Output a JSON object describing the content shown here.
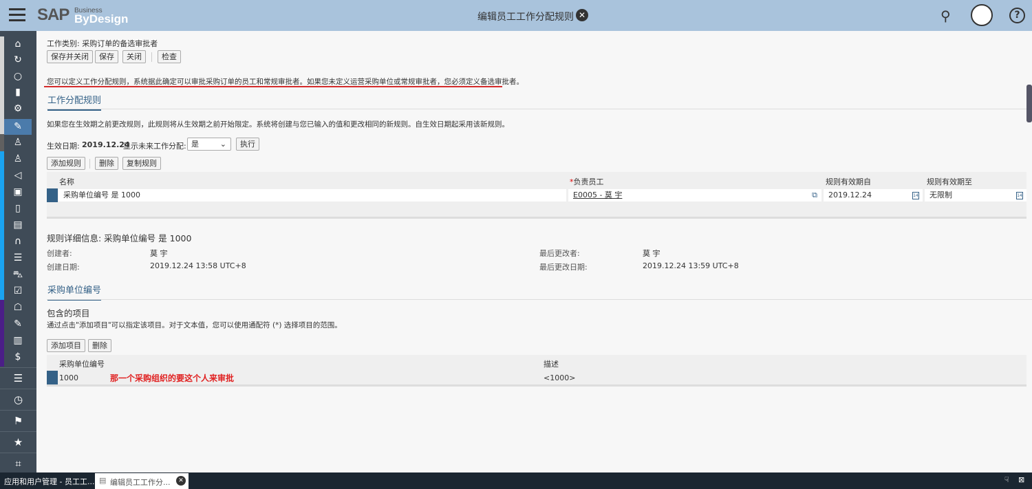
{
  "header": {
    "logo": "SAP",
    "logo_sub1": "Business",
    "logo_sub2": "ByDesign",
    "title": "编辑员工工作分配规则"
  },
  "sidebar": {
    "icons": [
      "home-icon",
      "refresh-icon",
      "circle-icon",
      "chart-icon",
      "gears-icon",
      "user-edit-icon",
      "org-icon",
      "user-list-icon",
      "megaphone-icon",
      "contact-card-icon",
      "invoice-icon",
      "employee-cost-icon",
      "headset-icon",
      "checklist-icon",
      "car-icon",
      "clipboard-check-icon",
      "handshake-icon",
      "edit-doc-icon",
      "receipt-icon",
      "expense-icon"
    ],
    "strip_colors": [
      "#d5d5d5",
      "#606060",
      "#1aa3f0",
      "#4b1e87"
    ]
  },
  "toolbar": {
    "work_category_label": "工作类别:",
    "work_category": "采购订单的备选审批者",
    "save_close": "保存并关闭",
    "save": "保存",
    "close": "关闭",
    "check": "检查"
  },
  "info": "您可以定义工作分配规则，系统据此确定可以审批采购订单的员工和常规审批者。如果您未定义运营采购单位或常规审批者，您必须定义备选审批者。",
  "rules": {
    "tab": "工作分配规则",
    "hint": "如果您在生效期之前更改规则，此规则将从生效期之前开始限定。系统将创建与您已输入的值和更改相同的新规则。自生效日期起采用该新规则。",
    "effective_label": "生效日期:",
    "effective_date": "2019.12.24",
    "future_label": "显示未来工作分配:",
    "future_value": "是",
    "execute": "执行",
    "add": "添加规则",
    "delete": "删除",
    "copy": "复制规则",
    "columns": [
      "名称",
      "负责员工",
      "规则有效期自",
      "规则有效期至"
    ],
    "required_mark": "*",
    "rows": [
      {
        "name": "采购单位编号 是 1000",
        "employee": "E0005 - 莫 宇",
        "from": "2019.12.24",
        "to": "无限制"
      }
    ]
  },
  "details": {
    "title": "规则详细信息: 采购单位编号 是 1000",
    "created_by_label": "创建者:",
    "created_by": "莫 宇",
    "created_on_label": "创建日期:",
    "created_on": "2019.12.24 13:58 UTC+8",
    "changed_by_label": "最后更改者:",
    "changed_by": "莫 宇",
    "changed_on_label": "最后更改日期:",
    "changed_on": "2019.12.24 13:59 UTC+8"
  },
  "purch": {
    "tab": "采购单位编号",
    "items_title": "包含的项目",
    "hint": "通过点击\"添加项目\"可以指定该项目。对于文本值，您可以使用通配符 (*) 选择项目的范围。",
    "add": "添加项目",
    "delete": "删除",
    "columns": [
      "采购单位编号",
      "描述"
    ],
    "rows": [
      {
        "id": "1000",
        "desc": "<1000>"
      }
    ],
    "annotation": "那一个采购组织的要这个人来审批"
  },
  "taskbar": {
    "tab1": "应用和用户管理 - 员工工...",
    "tab2": "编辑员工工作分..."
  },
  "colors": {
    "header": "#a9c3dc",
    "accent": "#346187",
    "annotation": "#e02020"
  }
}
